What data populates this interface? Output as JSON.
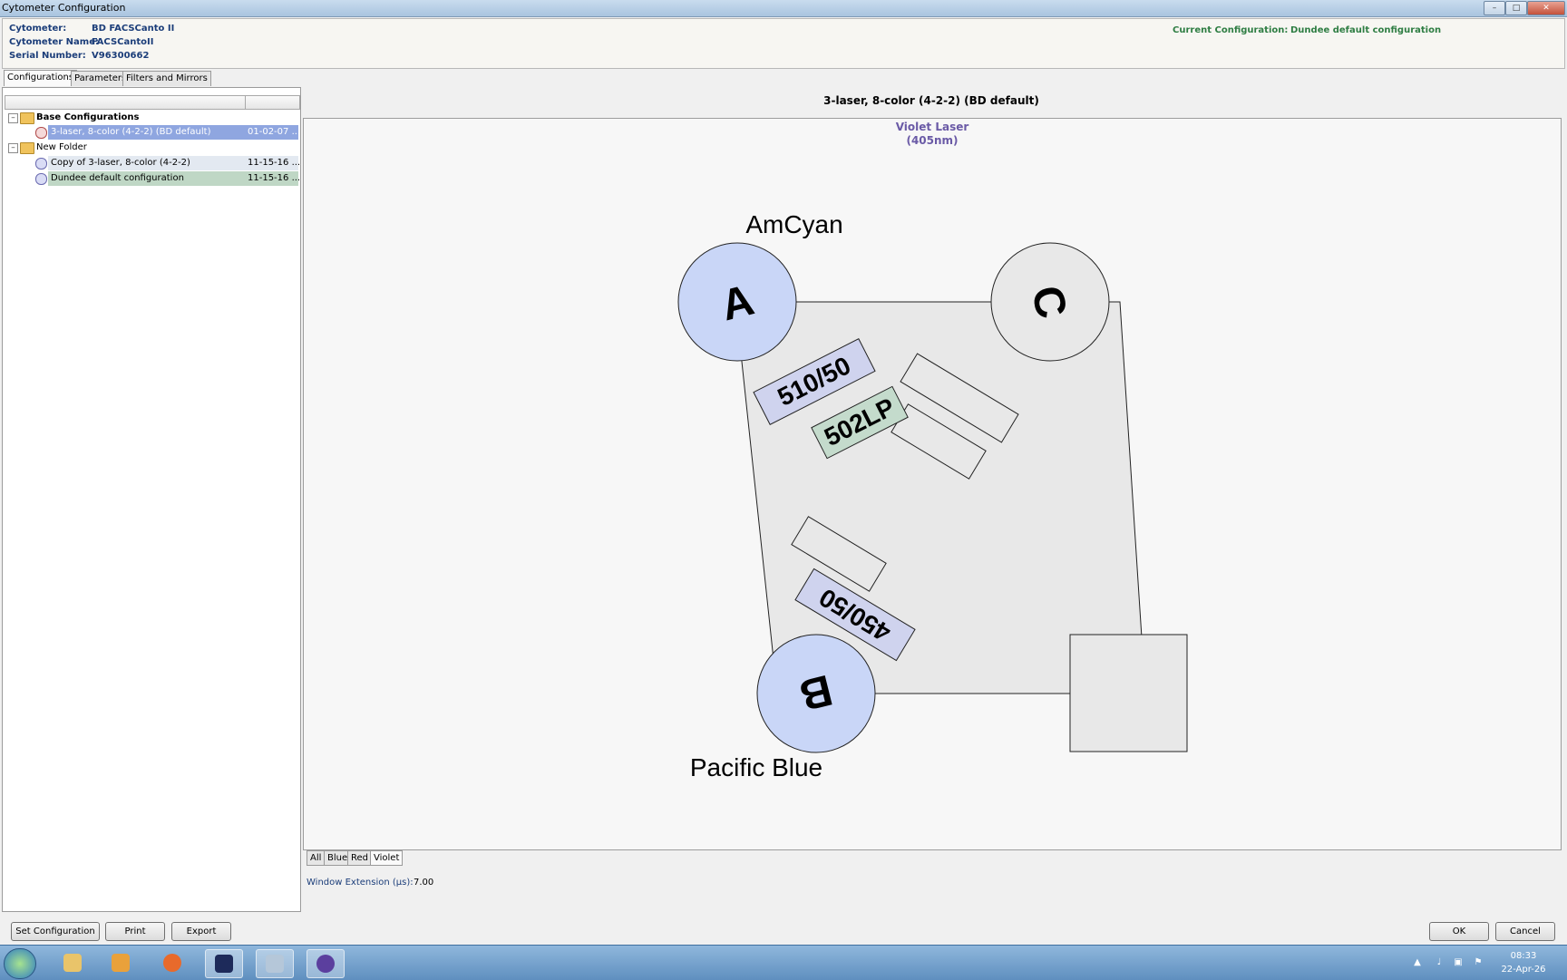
{
  "window": {
    "title": "Cytometer Configuration",
    "controls": [
      "minimize",
      "maximize",
      "close"
    ]
  },
  "info": {
    "cytometer_label": "Cytometer:",
    "cytometer_value": "BD FACSCanto II",
    "name_label": "Cytometer Name:",
    "name_value": "FACSCantoII",
    "serial_label": "Serial Number:",
    "serial_value": "V96300662",
    "current_label": "Current Configuration:",
    "current_value": "Dundee default configuration"
  },
  "tabs": [
    {
      "label": "Configurations",
      "active": true
    },
    {
      "label": "Parameters",
      "active": false
    },
    {
      "label": "Filters and  Mirrors",
      "active": false
    }
  ],
  "tree": {
    "base_folder": "Base Configurations",
    "base_items": [
      {
        "name": "3-laser, 8-color (4-2-2) (BD default)",
        "date": "01-02-07 ...",
        "selected": true
      }
    ],
    "new_folder": "New Folder",
    "new_items": [
      {
        "name": "Copy of 3-laser, 8-color (4-2-2)",
        "date": "11-15-16 ..."
      },
      {
        "name": "Dundee default configuration",
        "date": "11-15-16 ..."
      }
    ]
  },
  "config_title": "3-laser, 8-color (4-2-2) (BD default)",
  "laser": {
    "name": "Violet Laser",
    "wavelength": "(405nm)"
  },
  "detectors": {
    "a_letter": "A",
    "a_label": "AmCyan",
    "b_letter": "B",
    "b_label": "Pacific Blue",
    "c_letter": "C"
  },
  "filters": {
    "a_bandpass": "510/50",
    "a_longpass": "502LP",
    "b_bandpass": "450/50"
  },
  "laser_tabs": [
    {
      "label": "All",
      "active": false
    },
    {
      "label": "Blue",
      "active": false
    },
    {
      "label": "Red",
      "active": false
    },
    {
      "label": "Violet",
      "active": true
    }
  ],
  "window_extension": {
    "label": "Window Extension (µs):",
    "value": "7.00"
  },
  "buttons": {
    "set_configuration": "Set Configuration",
    "print": "Print",
    "export": "Export",
    "ok": "OK",
    "cancel": "Cancel"
  },
  "taskbar": {
    "time": "08:33",
    "date": "22-Apr-26",
    "pinned": [
      "start-orb",
      "file-explorer",
      "media-player",
      "firefox",
      "cytometer-app",
      "paint",
      "browser-globe"
    ]
  },
  "colors": {
    "detector_fill": "#c9d6f7",
    "bandpass_fill": "#cfd3ee",
    "longpass_fill": "#c4dbcc",
    "laser_text": "#6a5aa6",
    "label_blue": "#1b3d79",
    "current_green": "#2e7d43",
    "selection": "#8fa6e0"
  }
}
